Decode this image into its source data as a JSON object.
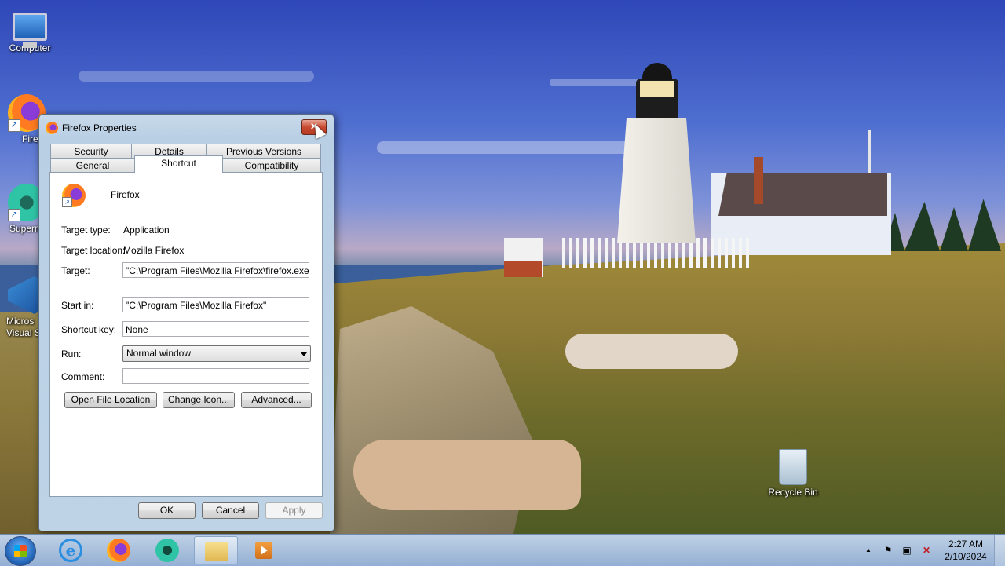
{
  "desktop": {
    "icons": [
      {
        "label": "Computer"
      },
      {
        "label": "Firefo"
      },
      {
        "label": "Superm"
      },
      {
        "label": "Micros\nVisual St"
      },
      {
        "label": "Recycle Bin"
      }
    ]
  },
  "dialog": {
    "title": "Firefox Properties",
    "close_glyph": "✕",
    "tabs_row1": [
      "Security",
      "Details",
      "Previous Versions"
    ],
    "tabs_row2": [
      "General",
      "Shortcut",
      "Compatibility"
    ],
    "active_tab": "Shortcut",
    "app_name": "Firefox",
    "fields": {
      "target_type_label": "Target type:",
      "target_type_value": "Application",
      "target_location_label": "Target location:",
      "target_location_value": "Mozilla Firefox",
      "target_label": "Target:",
      "target_value": "\"C:\\Program Files\\Mozilla Firefox\\firefox.exe\"",
      "start_in_label": "Start in:",
      "start_in_value": "\"C:\\Program Files\\Mozilla Firefox\"",
      "shortcut_key_label": "Shortcut key:",
      "shortcut_key_value": "None",
      "run_label": "Run:",
      "run_value": "Normal window",
      "comment_label": "Comment:",
      "comment_value": ""
    },
    "buttons": {
      "open_file_location": "Open File Location",
      "change_icon": "Change Icon...",
      "advanced": "Advanced...",
      "ok": "OK",
      "cancel": "Cancel",
      "apply": "Apply"
    }
  },
  "taskbar": {
    "clock_time": "2:27 AM",
    "clock_date": "2/10/2024",
    "tray_up": "▲",
    "tray_flag": "⚑",
    "tray_network": "▣",
    "tray_volume": "✕"
  },
  "colors": {
    "dialog_frame": "#bed3e6",
    "close_button": "#c84a30",
    "taskbar": "#a9c2e2"
  }
}
